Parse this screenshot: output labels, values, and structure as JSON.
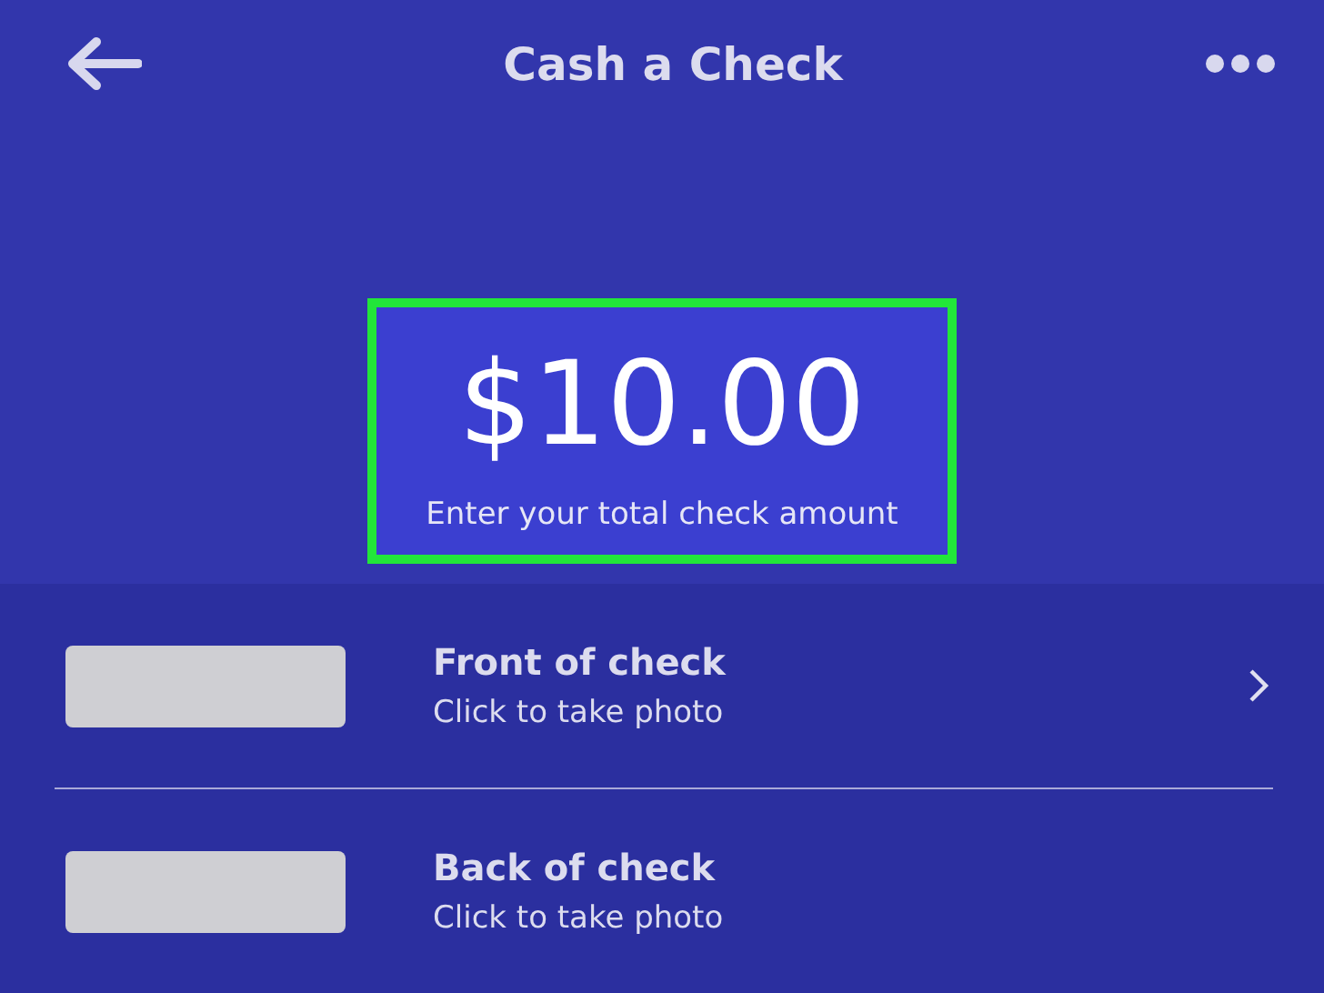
{
  "header": {
    "title": "Cash a Check"
  },
  "amount": {
    "value": "$10.00",
    "caption": "Enter your total check amount",
    "highlighted": true
  },
  "rows": [
    {
      "title": "Front of check",
      "subtitle": "Click to take photo",
      "chevron": true
    },
    {
      "title": "Back of check",
      "subtitle": "Click to take photo",
      "chevron": false
    }
  ]
}
